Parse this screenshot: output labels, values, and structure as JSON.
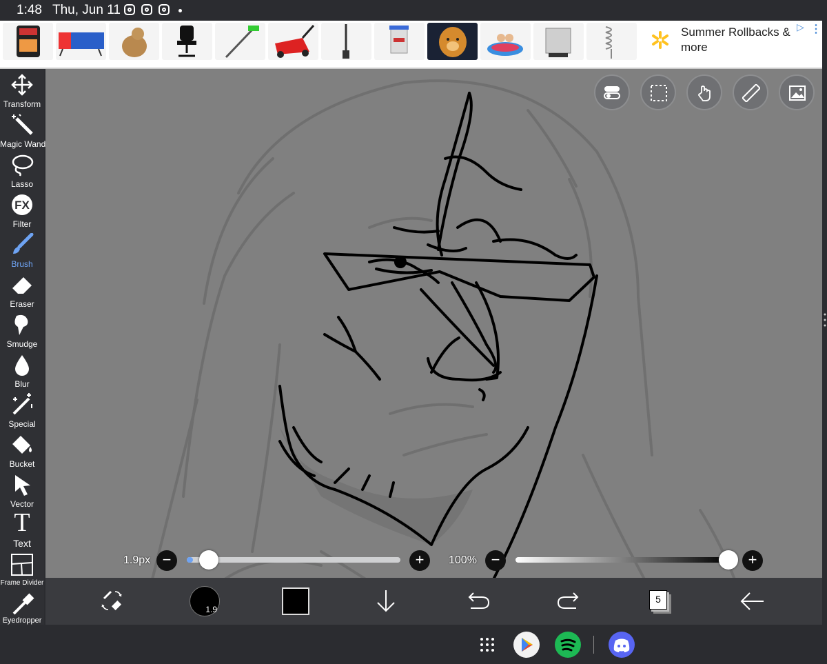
{
  "status": {
    "time": "1:48",
    "date": "Thu, Jun 11"
  },
  "ad": {
    "products": [
      "snack-bag",
      "camping-cot",
      "plush-toy",
      "office-chair",
      "string-trimmer",
      "lawn-mower",
      "brush-tool",
      "trophy-item",
      "dog-print",
      "kids-swing",
      "kitchen-scale",
      "coil-decor"
    ],
    "headline": "Summer Rollbacks & more",
    "brand_mark": "walmart-spark",
    "choice_icon": "ad-choices-icon"
  },
  "tools": [
    {
      "label": "Transform",
      "icon": "move-arrows-icon"
    },
    {
      "label": "Magic Wand",
      "icon": "magic-wand-icon"
    },
    {
      "label": "Lasso",
      "icon": "lasso-icon"
    },
    {
      "label": "Filter",
      "icon": "fx-icon"
    },
    {
      "label": "Brush",
      "icon": "brush-icon",
      "active": true
    },
    {
      "label": "Eraser",
      "icon": "eraser-icon"
    },
    {
      "label": "Smudge",
      "icon": "smudge-icon"
    },
    {
      "label": "Blur",
      "icon": "drop-icon"
    },
    {
      "label": "Special",
      "icon": "sparkle-wand-icon"
    },
    {
      "label": "Bucket",
      "icon": "bucket-icon"
    },
    {
      "label": "Vector",
      "icon": "cursor-icon"
    },
    {
      "label": "Text",
      "icon": "text-icon"
    },
    {
      "label": "Frame Divider",
      "icon": "frame-divider-icon"
    },
    {
      "label": "Eyedropper",
      "icon": "eyedropper-icon"
    }
  ],
  "filter_label": "FX",
  "text_glyph": "T",
  "canvas_buttons": [
    "toggle-icon",
    "selection-icon",
    "touch-icon",
    "ruler-icon",
    "image-icon"
  ],
  "brush": {
    "size_label": "1.9px",
    "size_short": "1.9",
    "size_fraction": 0.03
  },
  "opacity": {
    "label": "100%",
    "value": 1.0
  },
  "minus": "−",
  "plus": "+",
  "layers_count": "5",
  "colors": {
    "accent": "#6ea3f3",
    "current_color": "#000000",
    "canvas_bg": "#808080",
    "ui_dark": "#2f3034"
  },
  "nav_apps": [
    "app-drawer-icon",
    "play-store-icon",
    "spotify-icon",
    "discord-icon"
  ]
}
